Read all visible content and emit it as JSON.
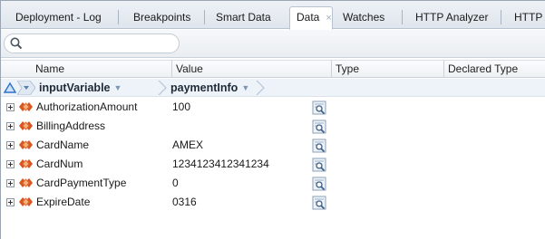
{
  "tabs": [
    {
      "label": "Deployment - Log",
      "active": false
    },
    {
      "label": "Breakpoints",
      "active": false
    },
    {
      "label": "Smart Data",
      "active": false
    },
    {
      "label": "Data",
      "active": true
    },
    {
      "label": "Watches",
      "active": false
    },
    {
      "label": "HTTP Analyzer",
      "active": false
    },
    {
      "label": "HTTP A",
      "active": false
    }
  ],
  "tab_close_glyph": "×",
  "search": {
    "placeholder": "",
    "value": "",
    "icon": "search-icon"
  },
  "table": {
    "columns": [
      "Name",
      "Value",
      "Type",
      "Declared Type"
    ],
    "breadcrumb": [
      "inputVariable",
      "paymentInfo"
    ],
    "rows": [
      {
        "name": "AuthorizationAmount",
        "value": "100"
      },
      {
        "name": "BillingAddress",
        "value": ""
      },
      {
        "name": "CardName",
        "value": "AMEX"
      },
      {
        "name": "CardNum",
        "value": "1234123412341234"
      },
      {
        "name": "CardPaymentType",
        "value": "0"
      },
      {
        "name": "ExpireDate",
        "value": "0316"
      }
    ]
  },
  "colors": {
    "accent": "#2f73c9",
    "variable_icon": "#d9541e",
    "active_tab_bg": "#ffffff"
  }
}
